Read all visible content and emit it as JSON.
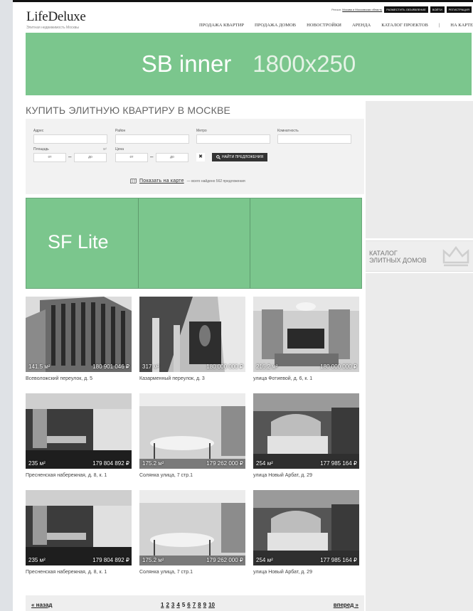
{
  "header": {
    "logo": "LifeDeluxe",
    "logo_tagline": "Элитная недвижимость Москвы",
    "region_prefix": "Регион:",
    "region_link": "Москва и Московская область",
    "buttons": [
      "Разместить объявление",
      "Войти",
      "Регистрация"
    ]
  },
  "nav": [
    "Продажа квартир",
    "Продажа домов",
    "Новостройки",
    "Аренда",
    "Каталог проектов",
    "|",
    "На карте"
  ],
  "banner": {
    "text1": "SB inner",
    "text2": "1800x250"
  },
  "page_title": "Купить элитную квартиру в Москве",
  "search": {
    "labels": {
      "address": "Адрес",
      "district": "Район",
      "metro": "Метро",
      "rooms": "Комнатность",
      "area": "Площадь",
      "price": "Цена"
    },
    "area_unit": "м²",
    "from_placeholder": "от",
    "to_placeholder": "до",
    "clear_symbol": "✖",
    "find_button": "Найти предложения",
    "map_link": "Показать на карте",
    "found_text": "— всего найдено 562 предложения"
  },
  "sf_lite": "SF Lite",
  "sidebar": {
    "catalog_line1": "Каталог",
    "catalog_line2": "элитных домов"
  },
  "listings": [
    {
      "area": "141.5 м²",
      "price": "180 901 046 ₽",
      "address": "Всеволожский переулок, д. 5"
    },
    {
      "area": "317 м²",
      "price": "180 000 000 ₽",
      "address": "Казарменный переулок, д. 3"
    },
    {
      "area": "216.2 м²",
      "price": "180 000 000 ₽",
      "address": "улица Фотиевой, д. 6, к. 1"
    },
    {
      "area": "235 м²",
      "price": "179 804 892 ₽",
      "address": "Пресненская набережная, д. 8, к. 1"
    },
    {
      "area": "175.2 м²",
      "price": "179 262 000 ₽",
      "address": "Солянка улица, 7 стр.1"
    },
    {
      "area": "254 м²",
      "price": "177 985 164 ₽",
      "address": "улица Новый Арбат, д. 29"
    },
    {
      "area": "235 м²",
      "price": "179 804 892 ₽",
      "address": "Пресненская набережная, д. 8, к. 1"
    },
    {
      "area": "175.2 м²",
      "price": "179 262 000 ₽",
      "address": "Солянка улица, 7 стр.1"
    },
    {
      "area": "254 м²",
      "price": "177 985 164 ₽",
      "address": "улица Новый Арбат, д. 29"
    }
  ],
  "pagination": {
    "prev": "« назад",
    "next": "вперед »",
    "pages": [
      "1",
      "2",
      "3",
      "4",
      "5",
      "6",
      "7",
      "8",
      "9",
      "10"
    ],
    "current": "5"
  },
  "colors": {
    "placeholder_green": "#7bc68d"
  }
}
